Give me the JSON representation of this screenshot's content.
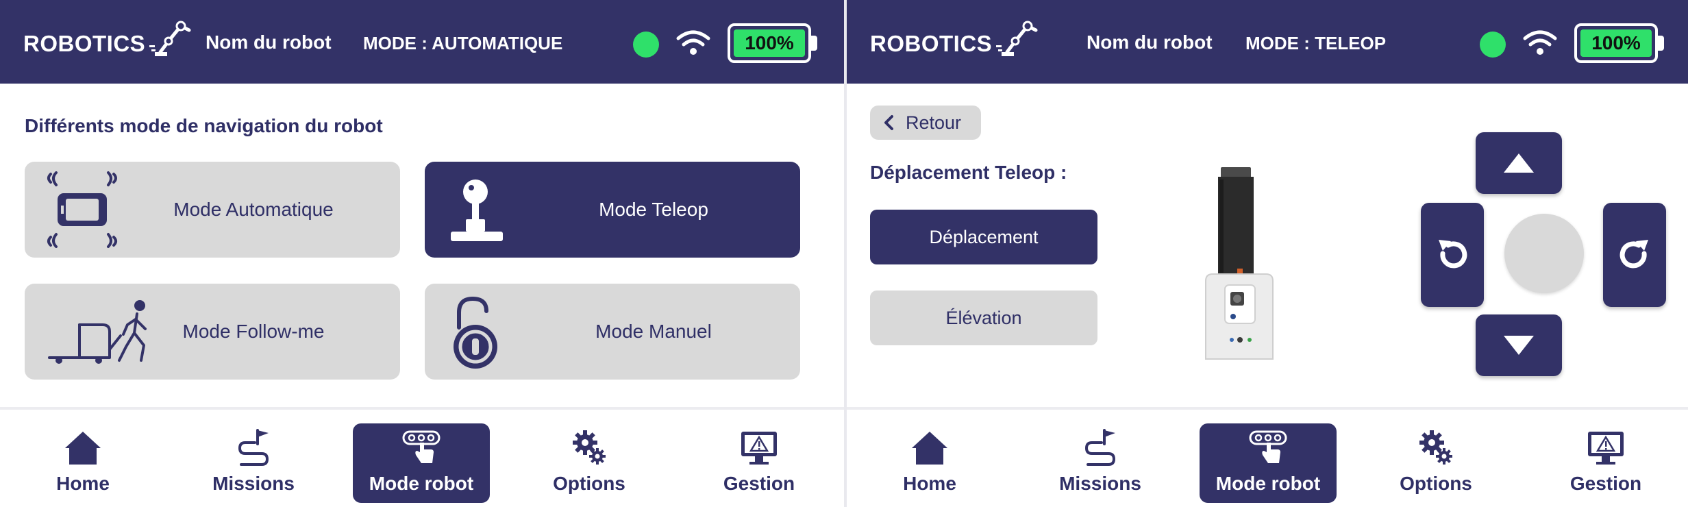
{
  "colors": {
    "primary": "#333267",
    "status_ok": "#2fe06a",
    "card_inactive": "#d9d9d9"
  },
  "left": {
    "header": {
      "logo_text": "ROBOTICS",
      "robot_name": "Nom du robot",
      "mode": "MODE : AUTOMATIQUE",
      "battery": "100%"
    },
    "section_title": "Différents mode de navigation du robot",
    "modes": [
      {
        "label": "Mode Automatique",
        "icon": "tablet-signal-icon",
        "active": false
      },
      {
        "label": "Mode Teleop",
        "icon": "joystick-icon",
        "active": true
      },
      {
        "label": "Mode Follow-me",
        "icon": "cart-walker-icon",
        "active": false
      },
      {
        "label": "Mode Manuel",
        "icon": "unlocked-padlock-icon",
        "active": false
      }
    ],
    "nav": [
      {
        "label": "Home",
        "icon": "home-icon",
        "active": false
      },
      {
        "label": "Missions",
        "icon": "route-flag-icon",
        "active": false
      },
      {
        "label": "Mode robot",
        "icon": "touch-remote-icon",
        "active": true
      },
      {
        "label": "Options",
        "icon": "gears-icon",
        "active": false
      },
      {
        "label": "Gestion",
        "icon": "monitor-alert-icon",
        "active": false
      }
    ]
  },
  "right": {
    "header": {
      "logo_text": "ROBOTICS",
      "robot_name": "Nom du robot",
      "mode": "MODE : TELEOP",
      "battery": "100%"
    },
    "back_label": "Retour",
    "teleop_title": "Déplacement Teleop :",
    "buttons": [
      {
        "label": "Déplacement",
        "active": true
      },
      {
        "label": "Élévation",
        "active": false
      }
    ],
    "nav": [
      {
        "label": "Home",
        "icon": "home-icon",
        "active": false
      },
      {
        "label": "Missions",
        "icon": "route-flag-icon",
        "active": false
      },
      {
        "label": "Mode robot",
        "icon": "touch-remote-icon",
        "active": true
      },
      {
        "label": "Options",
        "icon": "gears-icon",
        "active": false
      },
      {
        "label": "Gestion",
        "icon": "monitor-alert-icon",
        "active": false
      }
    ]
  }
}
